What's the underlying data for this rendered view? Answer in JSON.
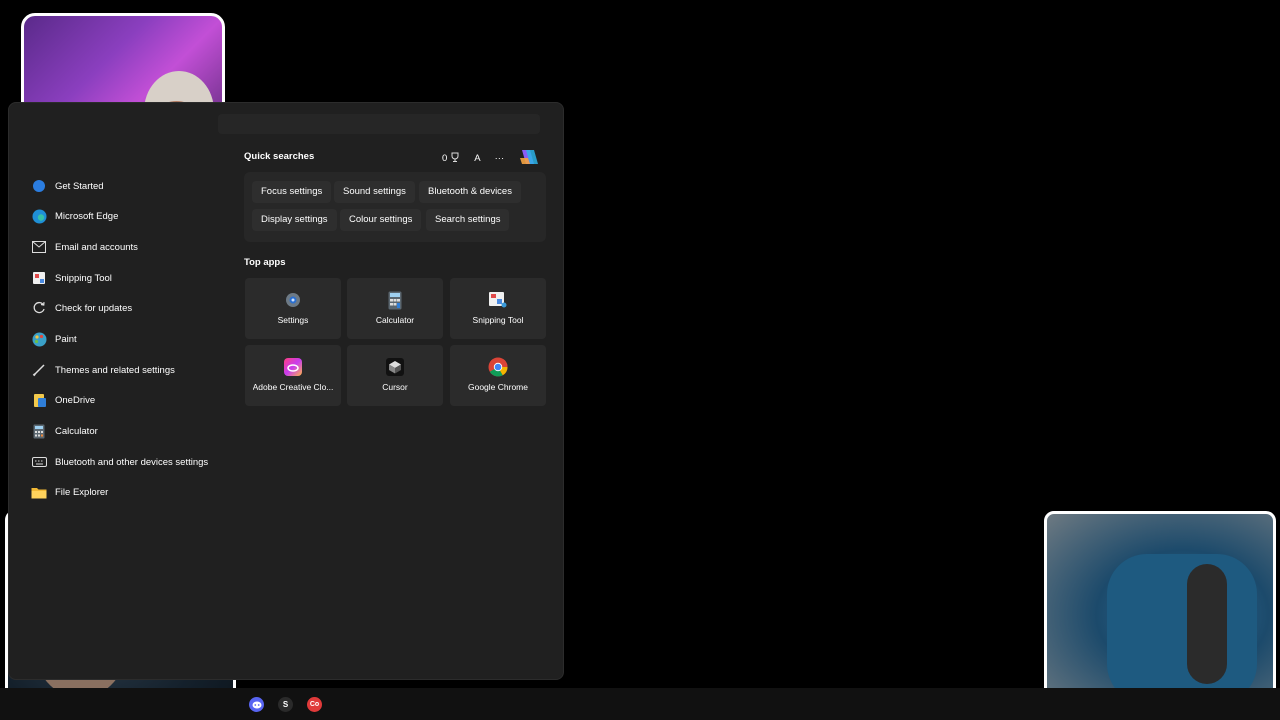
{
  "left_list": [
    {
      "label": "Get Started",
      "icon": "get-started-icon"
    },
    {
      "label": "Microsoft Edge",
      "icon": "edge-icon"
    },
    {
      "label": "Email and accounts",
      "icon": "mail-icon"
    },
    {
      "label": "Snipping Tool",
      "icon": "snipping-tool-icon"
    },
    {
      "label": "Check for updates",
      "icon": "refresh-icon"
    },
    {
      "label": "Paint",
      "icon": "paint-icon"
    },
    {
      "label": "Themes and related settings",
      "icon": "pen-icon"
    },
    {
      "label": "OneDrive",
      "icon": "onedrive-icon"
    },
    {
      "label": "Calculator",
      "icon": "calculator-icon"
    },
    {
      "label": "Bluetooth and other devices settings",
      "icon": "keyboard-icon"
    },
    {
      "label": "File Explorer",
      "icon": "folder-icon"
    }
  ],
  "quick_searches": {
    "title": "Quick searches",
    "points": "0",
    "account_letter": "A",
    "more": "···",
    "chips": [
      "Focus settings",
      "Sound settings",
      "Bluetooth & devices",
      "Display settings",
      "Colour settings",
      "Search settings"
    ]
  },
  "top_apps": {
    "title": "Top apps",
    "apps": [
      "Settings",
      "Calculator",
      "Snipping Tool",
      "Adobe Creative Clo...",
      "Cursor",
      "Google Chrome"
    ]
  },
  "taskbar": {
    "icons": [
      "discord-icon",
      "s-app-icon",
      "red-app-icon"
    ],
    "s_label": "S",
    "red_label": "Co"
  },
  "colors": {
    "panel": "#202020",
    "tile": "#2b2b2b",
    "accent": "#0078d4"
  }
}
